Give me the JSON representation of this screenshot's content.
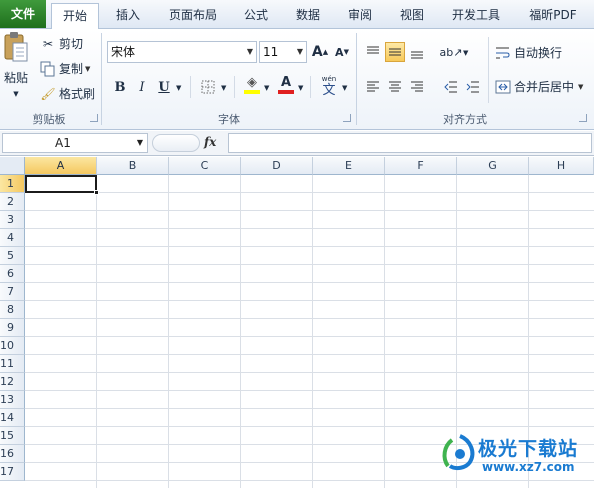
{
  "tabs": [
    {
      "label": "文件",
      "kind": "file"
    },
    {
      "label": "开始",
      "kind": "active"
    },
    {
      "label": "插入"
    },
    {
      "label": "页面布局"
    },
    {
      "label": "公式"
    },
    {
      "label": "数据"
    },
    {
      "label": "审阅"
    },
    {
      "label": "视图"
    },
    {
      "label": "开发工具"
    },
    {
      "label": "福昕PDF"
    }
  ],
  "clipboard": {
    "paste": "粘贴",
    "cut": "剪切",
    "copy": "复制",
    "format_painter": "格式刷",
    "label": "剪贴板"
  },
  "font": {
    "name": "宋体",
    "size": "11",
    "bold": "B",
    "italic": "I",
    "underline": "U",
    "grow": "A",
    "shrink": "A",
    "font_color_letter": "A",
    "phonetic": "wén",
    "phonetic_char": "文",
    "label": "字体"
  },
  "alignment": {
    "wrap": "自动换行",
    "merge": "合并后居中",
    "label": "对齐方式"
  },
  "formula_bar": {
    "name_box": "A1",
    "fx": "fx",
    "value": ""
  },
  "sheet": {
    "columns": [
      "A",
      "B",
      "C",
      "D",
      "E",
      "F",
      "G",
      "H"
    ],
    "rows": [
      "1",
      "2",
      "3",
      "4",
      "5",
      "6",
      "7",
      "8",
      "9",
      "10",
      "11",
      "12",
      "13",
      "14",
      "15",
      "16",
      "17"
    ],
    "selected": "A1"
  },
  "watermark": {
    "text": "极光下载站",
    "url": "www.xz7.com"
  },
  "colors": {
    "file_tab": "#2a7f28",
    "selection_header": "#f5c860",
    "fill_highlight": "#ffff00",
    "font_red": "#e02020",
    "watermark": "#1a7bd1"
  }
}
